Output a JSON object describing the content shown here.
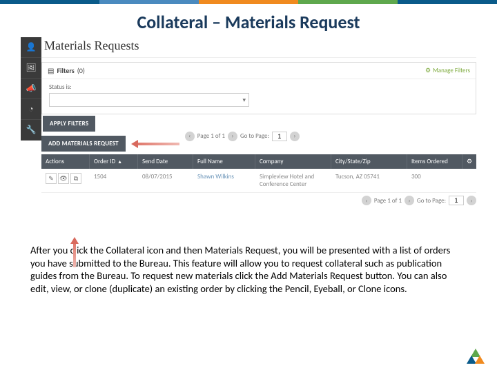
{
  "slide_title": "Collateral – Materials Request",
  "page_title": "Materials Requests",
  "sidebar": {
    "items": [
      {
        "name": "person-icon",
        "glyph": "👤"
      },
      {
        "name": "picture-icon",
        "glyph": "🖼"
      },
      {
        "name": "bullhorn-icon",
        "glyph": "📣"
      },
      {
        "name": "chart-icon",
        "glyph": "◔"
      },
      {
        "name": "wrench-icon",
        "glyph": "🔧"
      }
    ]
  },
  "filters": {
    "heading": "Filters",
    "count": "(0)",
    "manage": "Manage Filters",
    "status_label": "Status is:",
    "apply_label": "APPLY FILTERS"
  },
  "add_button": "ADD MATERIALS REQUEST",
  "pager": {
    "page_text": "Page 1 of 1",
    "goto_text": "Go to Page:",
    "page_input": "1"
  },
  "table": {
    "headers": {
      "actions": "Actions",
      "order_id": "Order ID",
      "send_date": "Send Date",
      "full_name": "Full Name",
      "company": "Company",
      "location": "City/State/Zip",
      "items": "Items Ordered"
    },
    "row": {
      "order_id": "1504",
      "send_date": "08/07/2015",
      "full_name": "Shawn Wilkins",
      "company": "Simpleview Hotel and Conference Center",
      "location": "Tucson, AZ 05741",
      "items": "300"
    }
  },
  "caption": "After you click the Collateral icon and then Materials Request, you will be presented with a list of orders you have submitted to the Bureau. This feature will allow you to request collateral such as publication guides from the Bureau.  To request new materials click the Add Materials Request button.  You can also edit, view, or clone (duplicate) an existing order by clicking the Pencil, Eyeball, or Clone icons."
}
